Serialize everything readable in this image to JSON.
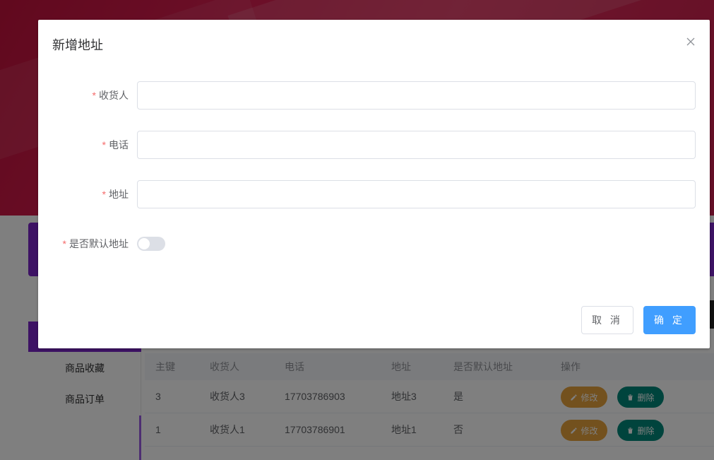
{
  "dialog": {
    "title": "新增地址",
    "fields": {
      "receiver": {
        "label": "收货人",
        "value": ""
      },
      "phone": {
        "label": "电话",
        "value": ""
      },
      "address": {
        "label": "地址",
        "value": ""
      },
      "is_default": {
        "label": "是否默认地址",
        "checked": false
      }
    },
    "required_mark": "*",
    "cancel_label": "取 消",
    "confirm_label": "确 定"
  },
  "sidebar": {
    "items": [
      {
        "label": "商品收藏"
      },
      {
        "label": "商品订单"
      }
    ]
  },
  "table": {
    "headers": [
      "主键",
      "收货人",
      "电话",
      "地址",
      "是否默认地址",
      "操作"
    ],
    "rows": [
      {
        "key": "3",
        "name": "收货人3",
        "phone": "17703786903",
        "address": "地址3",
        "is_default": "是"
      },
      {
        "key": "1",
        "name": "收货人1",
        "phone": "17703786901",
        "address": "地址1",
        "is_default": "否"
      }
    ],
    "edit_label": "修改",
    "delete_label": "删除"
  },
  "colors": {
    "primary": "#409eff",
    "edit": "#e6a23c",
    "delete": "#00897b",
    "accent_purple": "#7b24c8",
    "required": "#f56c6c"
  },
  "icons": {
    "close": "close-icon",
    "edit": "pencil-icon",
    "delete": "trash-icon"
  }
}
